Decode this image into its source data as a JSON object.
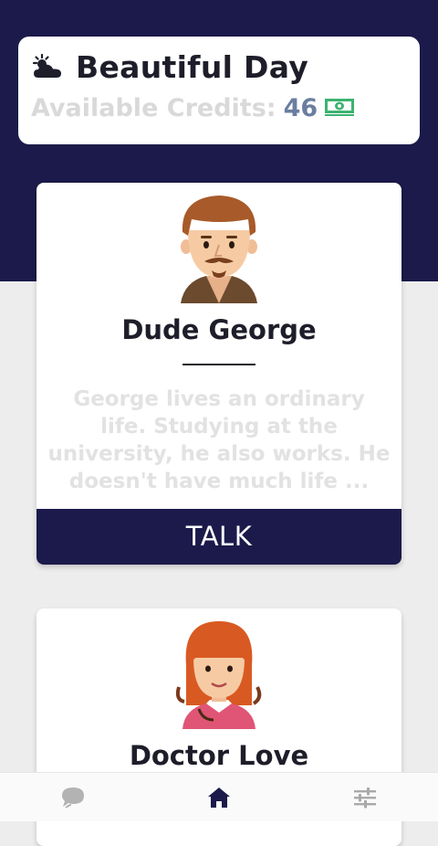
{
  "header": {
    "title": "Beautiful Day",
    "credits_label": "Available Credits:",
    "credits_value": "46",
    "weather_icon": "partly-cloudy-icon",
    "money_icon": "money-icon",
    "money_color": "#3cb371"
  },
  "characters": [
    {
      "name": "Dude George",
      "description": "George lives an ordinary life. Studying at the university, he also works. He doesn't have much life ...",
      "button": "TALK",
      "avatar_icon": "george-avatar-icon"
    },
    {
      "name": "Doctor Love",
      "avatar_icon": "doctor-love-avatar-icon"
    }
  ],
  "bottom_nav": {
    "items": [
      "chat-icon",
      "home-icon",
      "settings-sliders-icon"
    ],
    "active": "home-icon"
  },
  "colors": {
    "primary": "#1b1a4a",
    "background": "#ededed",
    "credits_value": "#6b7ea0"
  }
}
